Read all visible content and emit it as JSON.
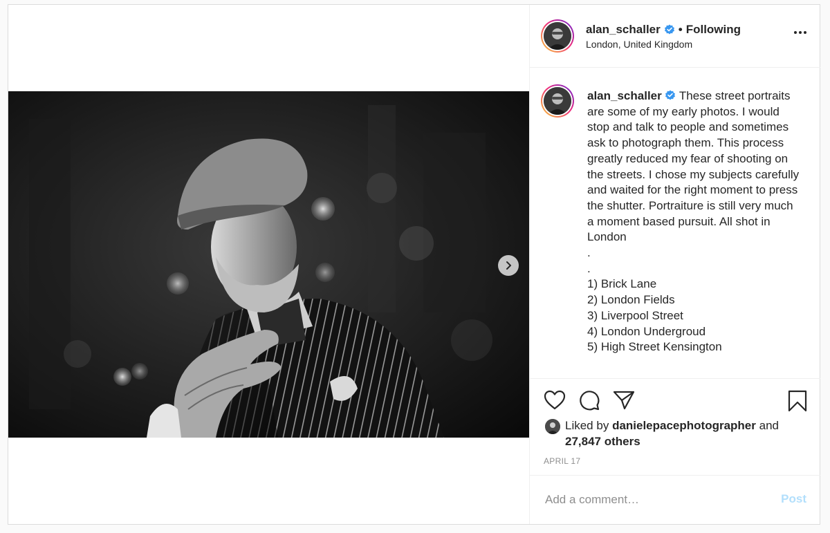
{
  "post": {
    "username": "alan_schaller",
    "follow_status": "Following",
    "separator": "•",
    "location": "London, United Kingdom",
    "caption_text": "These street portraits are some of my early photos. I would stop and talk to people and sometimes ask to photograph them. This process greatly reduced my fear of shooting on the streets. I chose my subjects carefully and waited for the right moment to press the shutter. Portraiture is still very much a moment based pursuit. All shot in London\n.\n.\n1) Brick Lane\n2) London Fields\n3) Liverpool Street\n4) London Undergroud\n5) High Street Kensington",
    "liked_by_prefix": "Liked by",
    "liked_by_user": "danielepacephotographer",
    "liked_by_and": "and",
    "liked_by_others": "27,847 others",
    "date": "APRIL 17",
    "comment_placeholder": "Add a comment…",
    "post_button": "Post"
  },
  "icons": {
    "verified": "verified-badge-icon",
    "more": "more-options-icon",
    "next": "chevron-right-icon",
    "like": "heart-icon",
    "comment": "comment-icon",
    "share": "paper-plane-icon",
    "save": "bookmark-icon"
  },
  "colors": {
    "verified_blue": "#3897f0",
    "post_button_disabled": "#b2dffc",
    "border": "#dbdbdb",
    "meta_gray": "#8e8e8e"
  }
}
